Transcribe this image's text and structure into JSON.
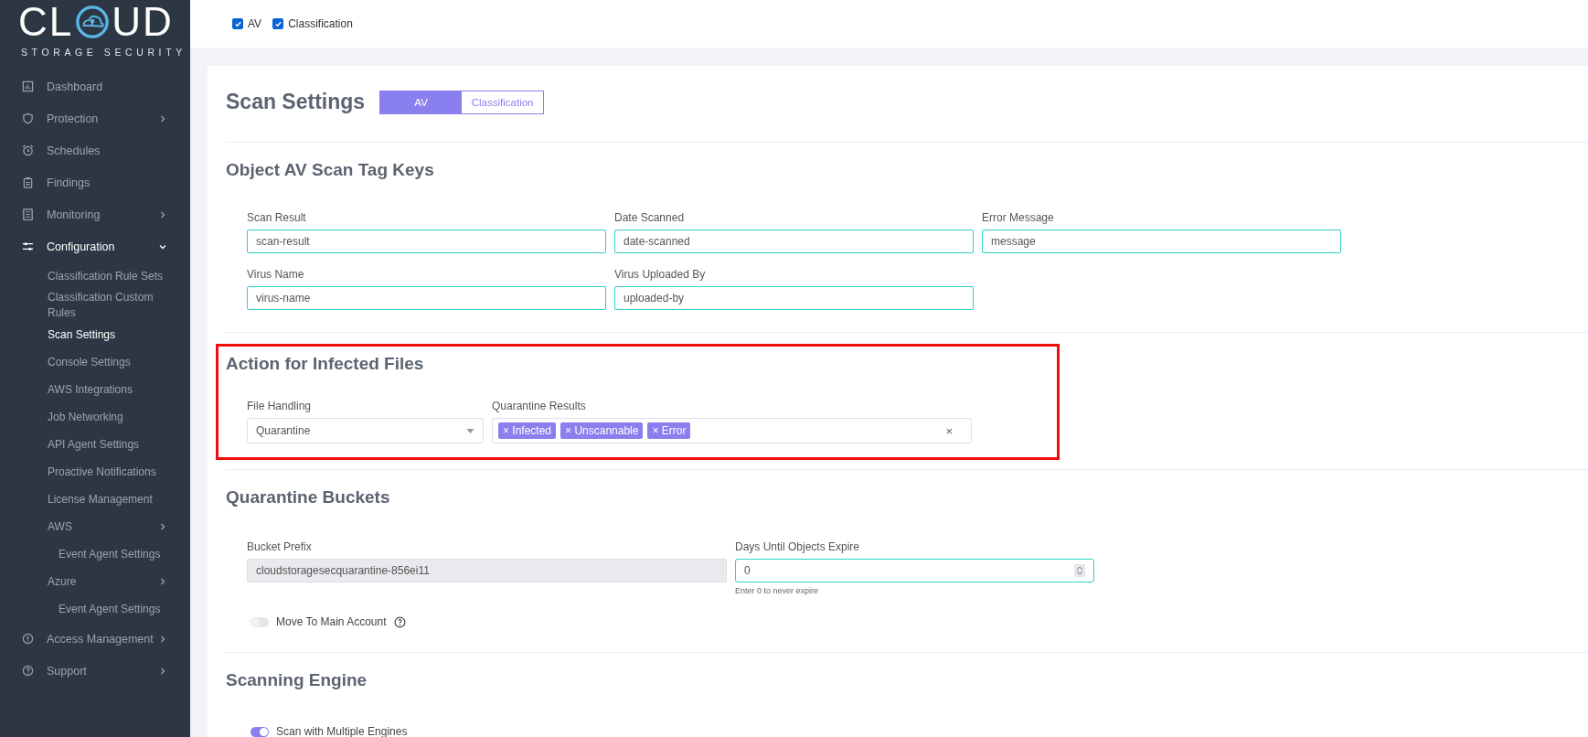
{
  "logo": {
    "word_start": "CL",
    "word_end": "UD",
    "tagline": "STORAGE SECURITY"
  },
  "sidebar": {
    "items": [
      {
        "label": "Dashboard",
        "submenu": false,
        "expanded": false
      },
      {
        "label": "Protection",
        "submenu": true,
        "expanded": false
      },
      {
        "label": "Schedules",
        "submenu": false,
        "expanded": false
      },
      {
        "label": "Findings",
        "submenu": false,
        "expanded": false
      },
      {
        "label": "Monitoring",
        "submenu": true,
        "expanded": false
      },
      {
        "label": "Configuration",
        "submenu": true,
        "expanded": true,
        "children": [
          {
            "label": "Classification Rule Sets",
            "selected": false,
            "submenu": false
          },
          {
            "label": "Classification Custom Rules",
            "selected": false,
            "submenu": false
          },
          {
            "label": "Scan Settings",
            "selected": true,
            "submenu": false
          },
          {
            "label": "Console Settings",
            "selected": false,
            "submenu": false
          },
          {
            "label": "AWS Integrations",
            "selected": false,
            "submenu": false
          },
          {
            "label": "Job Networking",
            "selected": false,
            "submenu": false
          },
          {
            "label": "API Agent Settings",
            "selected": false,
            "submenu": false
          },
          {
            "label": "Proactive Notifications",
            "selected": false,
            "submenu": false
          },
          {
            "label": "License Management",
            "selected": false,
            "submenu": false
          },
          {
            "label": "AWS",
            "selected": false,
            "submenu": true,
            "children": [
              {
                "label": "Event Agent Settings",
                "selected": false
              }
            ]
          },
          {
            "label": "Azure",
            "selected": false,
            "submenu": true,
            "children": [
              {
                "label": "Event Agent Settings",
                "selected": false
              }
            ]
          }
        ]
      },
      {
        "label": "Access Management",
        "submenu": true,
        "expanded": false
      },
      {
        "label": "Support",
        "submenu": true,
        "expanded": false
      }
    ]
  },
  "top_filters": [
    {
      "label": "AV",
      "checked": true
    },
    {
      "label": "Classification",
      "checked": true
    }
  ],
  "page_title": "Scan Settings",
  "tabs": [
    {
      "label": "AV",
      "selected": true
    },
    {
      "label": "Classification",
      "selected": false
    }
  ],
  "tag_keys": {
    "title": "Object AV Scan Tag Keys",
    "fields": [
      {
        "label": "Scan Result",
        "value": "scan-result"
      },
      {
        "label": "Date Scanned",
        "value": "date-scanned"
      },
      {
        "label": "Error Message",
        "value": "message"
      },
      {
        "label": "Virus Name",
        "value": "virus-name"
      },
      {
        "label": "Virus Uploaded By",
        "value": "uploaded-by"
      }
    ]
  },
  "infected_action": {
    "title": "Action for Infected Files",
    "highlighted": true,
    "file_handling": {
      "label": "File Handling",
      "value": "Quarantine"
    },
    "quarantine_results": {
      "label": "Quarantine Results",
      "tags": [
        "Infected",
        "Unscannable",
        "Error"
      ],
      "clear": "×",
      "remove": "×"
    }
  },
  "quarantine_buckets": {
    "title": "Quarantine Buckets",
    "bucket_prefix": {
      "label": "Bucket Prefix",
      "value": "cloudstoragesecquarantine-856ei11",
      "disabled": true
    },
    "days": {
      "label": "Days Until Objects Expire",
      "value": "0",
      "hint": "Enter 0 to never expire"
    },
    "move_to_main": {
      "label": "Move To Main Account",
      "on": false
    }
  },
  "scanning_engine": {
    "title": "Scanning Engine",
    "multiple_engines": {
      "label": "Scan with Multiple Engines",
      "on": true
    }
  }
}
